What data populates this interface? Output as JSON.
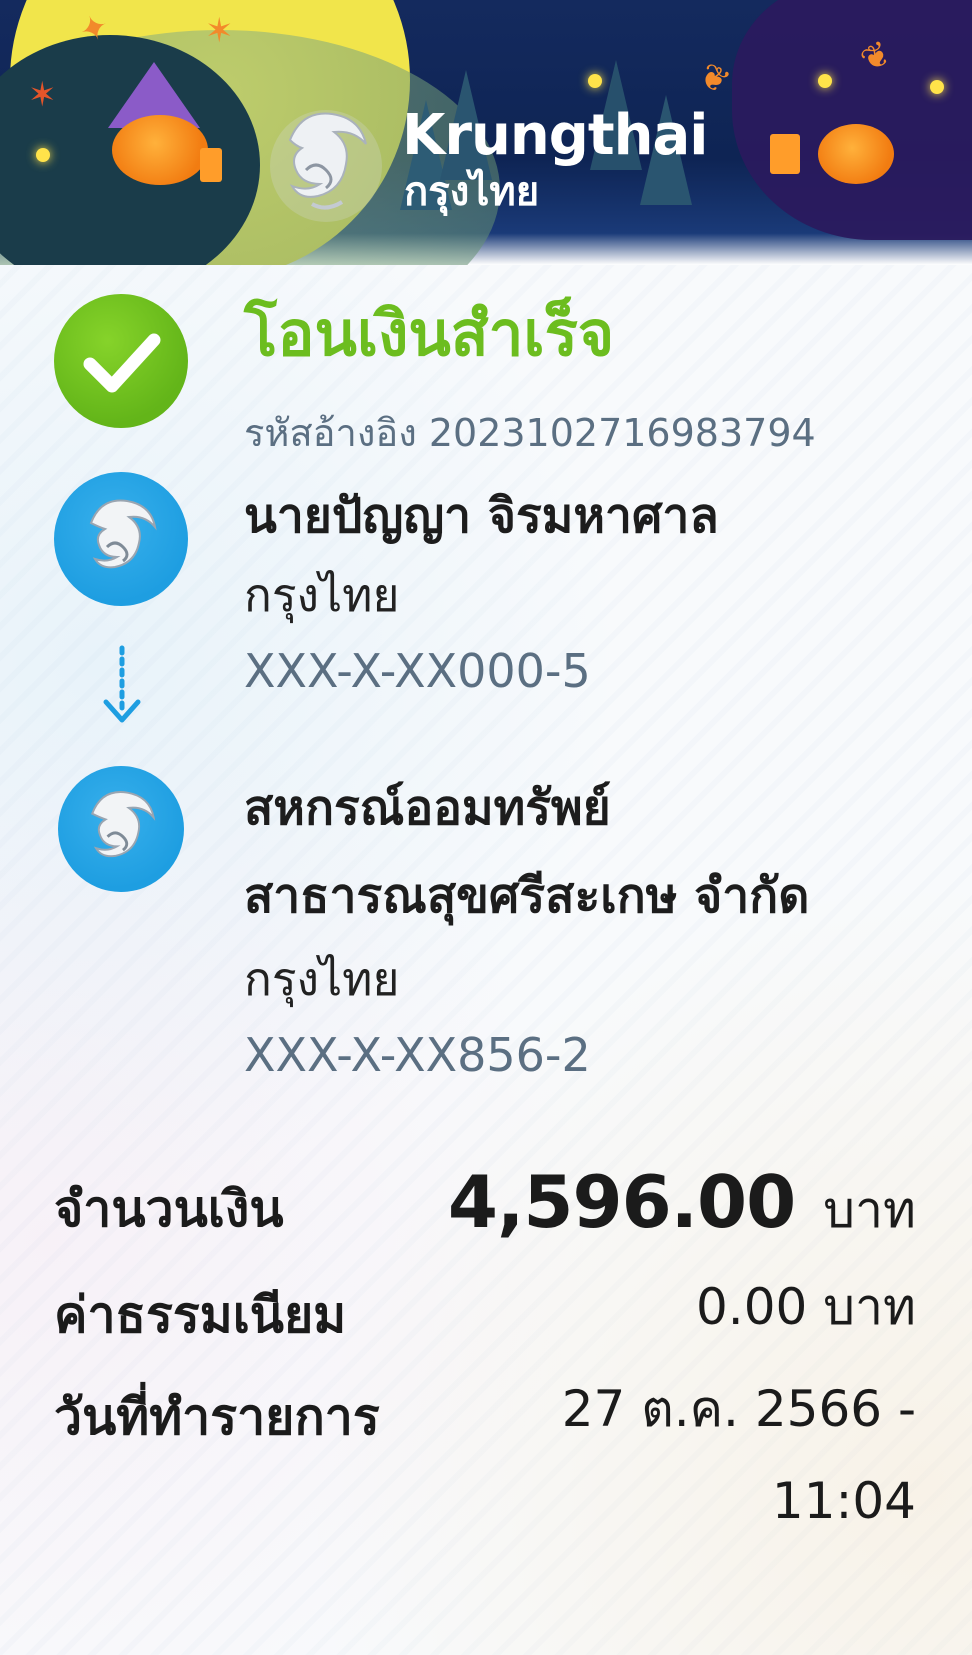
{
  "header": {
    "brand_name": "Krungthai",
    "brand_thai": "กรุงไทย",
    "logo_icon": "krungthai-phoenix-logo",
    "colors": {
      "banner_navy": "#0e2454",
      "moon_yellow": "#f1e54b",
      "pumpkin_orange": "#f27c11"
    }
  },
  "status": {
    "icon": "check-circle-icon",
    "title": "โอนเงินสำเร็จ",
    "ref_label": "รหัสอ้างอิง",
    "ref_value": "2023102716983794",
    "color": "#6cbd1f"
  },
  "sender": {
    "name": "นายปัญญา จิรมหาศาล",
    "bank": "กรุงไทย",
    "account": "XXX-X-XX000-5"
  },
  "transfer_arrow_icon": "arrow-down-icon",
  "receiver": {
    "name_line1": "สหกรณ์ออมทรัพย์",
    "name_line2": "สาธารณสุขศรีสะเกษ จำกัด",
    "bank": "กรุงไทย",
    "account": "XXX-X-XX856-2"
  },
  "details": {
    "amount_label": "จำนวนเงิน",
    "amount_value": "4,596.00",
    "amount_unit": "บาท",
    "fee_label": "ค่าธรรมเนียม",
    "fee_value": "0.00 บาท",
    "date_label": "วันที่ทำรายการ",
    "date_line1": "27 ต.ค. 2566 -",
    "date_line2": "11:04"
  }
}
